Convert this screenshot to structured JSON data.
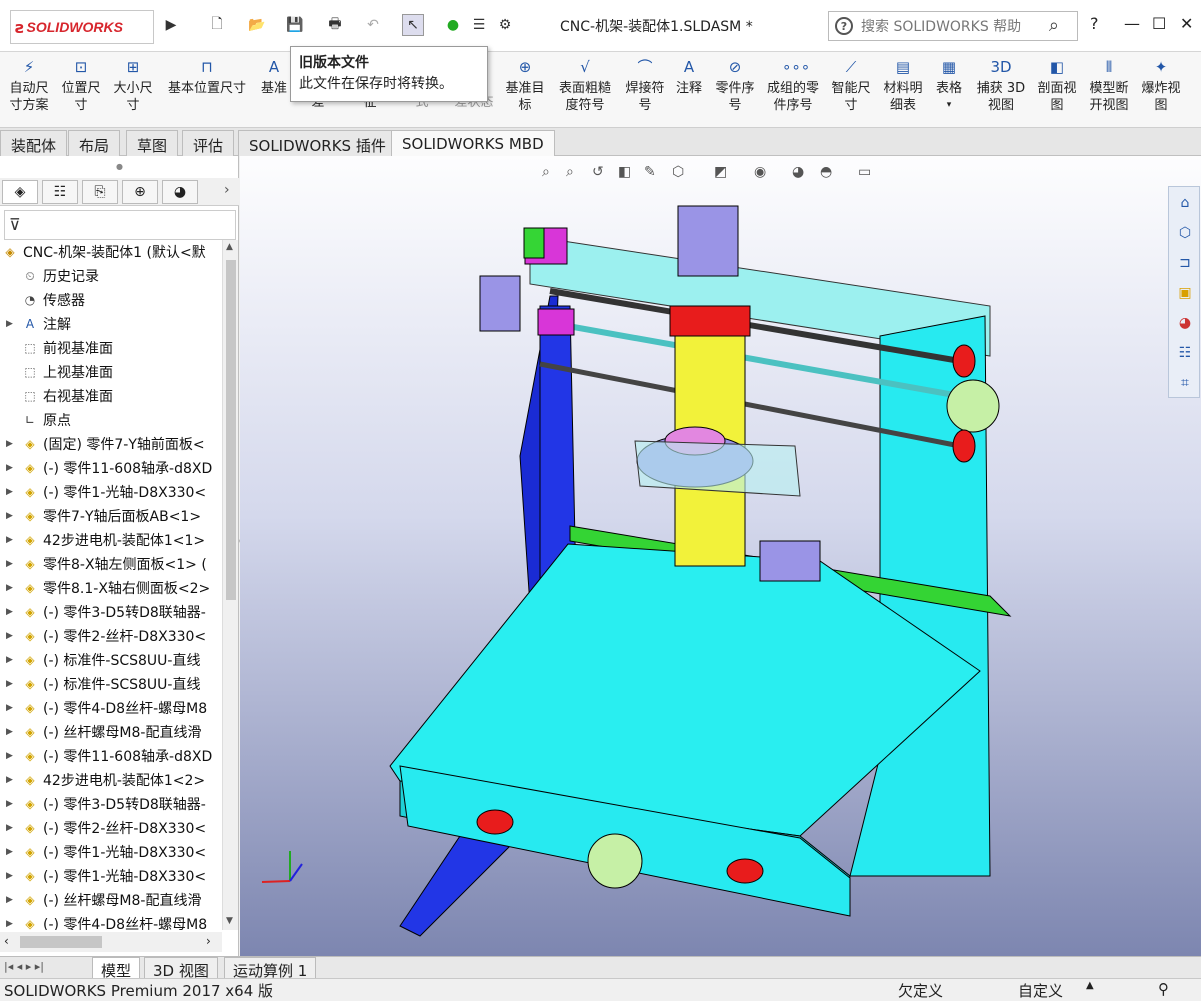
{
  "app": {
    "logo": "SOLIDWORKS",
    "document_title": "CNC-机架-装配体1.SLDASM *"
  },
  "search": {
    "placeholder": "搜索 SOLIDWORKS 帮助"
  },
  "window_controls": {
    "minimize": "—",
    "maximize": "☐",
    "close": "✕",
    "help": "?"
  },
  "tooltip": {
    "title": "旧版本文件",
    "body": "此文件在保存时将转换。"
  },
  "ribbon": {
    "items": [
      {
        "label": "自动尺\n寸方案",
        "icon": "auto-dimension-icon"
      },
      {
        "label": "位置尺\n寸",
        "icon": "location-dimension-icon"
      },
      {
        "label": "大小尺\n寸",
        "icon": "size-dimension-icon"
      },
      {
        "label": "基本位置尺寸",
        "icon": "basic-location-icon"
      },
      {
        "label": "基准",
        "icon": "datum-icon"
      },
      {
        "label": "差",
        "icon": "tolerance-icon"
      },
      {
        "label": "征",
        "icon": "feature-icon"
      },
      {
        "label": "式",
        "icon": "pattern-icon"
      },
      {
        "label": "差状态",
        "icon": "tolerance-status-icon"
      },
      {
        "label": "基准目\n标",
        "icon": "datum-target-icon"
      },
      {
        "label": "表面粗糙\n度符号",
        "icon": "surface-finish-icon"
      },
      {
        "label": "焊接符\n号",
        "icon": "weld-symbol-icon"
      },
      {
        "label": "注释",
        "icon": "note-icon"
      },
      {
        "label": "零件序\n号",
        "icon": "balloon-icon"
      },
      {
        "label": "成组的零\n件序号",
        "icon": "stacked-balloon-icon"
      },
      {
        "label": "智能尺\n寸",
        "icon": "smart-dimension-icon"
      },
      {
        "label": "材料明\n细表",
        "icon": "bom-icon"
      },
      {
        "label": "表格",
        "icon": "table-icon"
      },
      {
        "label": "捕获 3D\n视图",
        "icon": "capture-3d-view-icon"
      },
      {
        "label": "剖面视\n图",
        "icon": "section-view-icon"
      },
      {
        "label": "模型断\n开视图",
        "icon": "model-break-view-icon"
      },
      {
        "label": "爆炸视\n图",
        "icon": "exploded-view-icon"
      }
    ]
  },
  "command_tabs": [
    "装配体",
    "布局",
    "草图",
    "评估",
    "SOLIDWORKS 插件",
    "SOLIDWORKS MBD"
  ],
  "tree": {
    "root": "CNC-机架-装配体1 (默认<默",
    "items": [
      {
        "label": "历史记录",
        "expand": false,
        "icon": "history-icon"
      },
      {
        "label": "传感器",
        "expand": false,
        "icon": "sensor-icon"
      },
      {
        "label": "注解",
        "expand": true,
        "icon": "annotation-icon"
      },
      {
        "label": "前视基准面",
        "expand": false,
        "icon": "plane-icon"
      },
      {
        "label": "上视基准面",
        "expand": false,
        "icon": "plane-icon"
      },
      {
        "label": "右视基准面",
        "expand": false,
        "icon": "plane-icon"
      },
      {
        "label": "原点",
        "expand": false,
        "icon": "origin-icon"
      },
      {
        "label": "(固定) 零件7-Y轴前面板<",
        "expand": true,
        "icon": "part-icon"
      },
      {
        "label": "(-) 零件11-608轴承-d8XD",
        "expand": true,
        "icon": "part-icon"
      },
      {
        "label": "(-) 零件1-光轴-D8X330<",
        "expand": true,
        "icon": "part-icon"
      },
      {
        "label": "零件7-Y轴后面板AB<1>",
        "expand": true,
        "icon": "part-icon"
      },
      {
        "label": "42步进电机-装配体1<1>",
        "expand": true,
        "icon": "assembly-icon"
      },
      {
        "label": "零件8-X轴左侧面板<1> (",
        "expand": true,
        "icon": "part-icon"
      },
      {
        "label": "零件8.1-X轴右侧面板<2>",
        "expand": true,
        "icon": "part-icon"
      },
      {
        "label": "(-) 零件3-D5转D8联轴器-",
        "expand": true,
        "icon": "part-icon"
      },
      {
        "label": "(-) 零件2-丝杆-D8X330<",
        "expand": true,
        "icon": "part-icon"
      },
      {
        "label": "(-) 标准件-SCS8UU-直线",
        "expand": true,
        "icon": "part-icon"
      },
      {
        "label": "(-) 标准件-SCS8UU-直线",
        "expand": true,
        "icon": "part-icon"
      },
      {
        "label": "(-) 零件4-D8丝杆-螺母M8",
        "expand": true,
        "icon": "part-icon"
      },
      {
        "label": "(-) 丝杆螺母M8-配直线滑",
        "expand": true,
        "icon": "part-icon"
      },
      {
        "label": "(-) 零件11-608轴承-d8XD",
        "expand": true,
        "icon": "part-icon"
      },
      {
        "label": "42步进电机-装配体1<2>",
        "expand": true,
        "icon": "assembly-icon"
      },
      {
        "label": "(-) 零件3-D5转D8联轴器-",
        "expand": true,
        "icon": "part-icon"
      },
      {
        "label": "(-) 零件2-丝杆-D8X330<",
        "expand": true,
        "icon": "part-icon"
      },
      {
        "label": "(-) 零件1-光轴-D8X330<",
        "expand": true,
        "icon": "part-icon"
      },
      {
        "label": "(-) 零件1-光轴-D8X330<",
        "expand": true,
        "icon": "part-icon"
      },
      {
        "label": "(-) 丝杆螺母M8-配直线滑",
        "expand": true,
        "icon": "part-icon"
      },
      {
        "label": "(-) 零件4-D8丝杆-螺母M8",
        "expand": true,
        "icon": "part-icon"
      }
    ]
  },
  "bottom_tabs": [
    "模型",
    "3D 视图",
    "运动算例 1"
  ],
  "status": {
    "product": "SOLIDWORKS Premium 2017 x64 版",
    "definition": "欠定义",
    "units": "自定义"
  },
  "colors": {
    "brand": "#d7262d",
    "cyan": "#22e7ee",
    "blue": "#1a2bd4",
    "yellow": "#f2f23a",
    "lavender": "#9a94e6",
    "red": "#e81c1c",
    "magenta": "#d836d8",
    "green": "#35d535"
  }
}
